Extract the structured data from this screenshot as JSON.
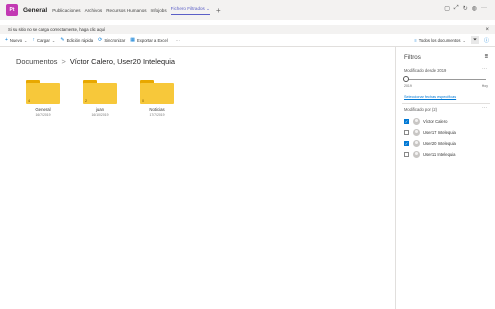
{
  "header": {
    "team_initials": "Pt",
    "channel": "General",
    "tabs": [
      "Publicaciones",
      "Archivos",
      "Recursos Humanos",
      "Infojobs",
      "Fichero Filtrados"
    ],
    "active_tab_index": 4,
    "add_tab": "+"
  },
  "notice": {
    "message": "Si su sitio no se carga correctamente, haga clic aquí",
    "close": "×"
  },
  "commands": {
    "new": "Nuevo",
    "upload": "Cargar",
    "quick_edit": "Edición rápida",
    "sync": "Sincronizar",
    "export": "Exportar a Excel",
    "more": "···",
    "view": "Todos los documentos"
  },
  "breadcrumb": {
    "root": "Documentos",
    "separator": ">",
    "current": "Víctor Calero, User20 Intelequia"
  },
  "folders": [
    {
      "name": "General",
      "date": "16/7/2019",
      "count": "4"
    },
    {
      "name": "juan",
      "date": "16/10/2019",
      "count": "2"
    },
    {
      "name": "Noticias",
      "date": "17/7/2019",
      "count": "0"
    }
  ],
  "filters": {
    "title": "Filtros",
    "modified_label": "Modificado desde 2019",
    "slider_min": "2019",
    "slider_max": "Hoy",
    "slider_fraction": 0,
    "date_link": "Seleccionar fechas específicas",
    "modified_by_label": "Modificado por (2)",
    "more": "···",
    "people": [
      {
        "name": "Víctor Calero",
        "checked": true
      },
      {
        "name": "User17 Intelequia",
        "checked": false
      },
      {
        "name": "User20 Intelequia",
        "checked": true
      },
      {
        "name": "User11 Intelequia",
        "checked": false
      }
    ]
  },
  "colors": {
    "accent": "#5b5fc7",
    "link": "#0078d4",
    "folder": "#f7c83a",
    "team_tile": "#c239b3"
  }
}
